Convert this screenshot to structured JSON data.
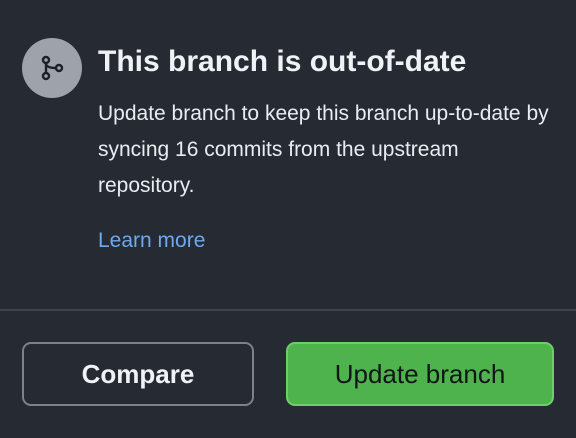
{
  "notice": {
    "icon": "git-branch-icon",
    "title": "This branch is out-of-date",
    "description": "Update branch to keep this branch up-to-date by syncing 16 commits from the upstream repository.",
    "learn_more": "Learn more"
  },
  "actions": {
    "compare_label": "Compare",
    "update_label": "Update branch"
  },
  "colors": {
    "background": "#262a32",
    "icon_circle": "#9ea3ab",
    "link": "#6fa8ee",
    "primary_button": "#4fb34d",
    "divider": "#3f444c"
  }
}
